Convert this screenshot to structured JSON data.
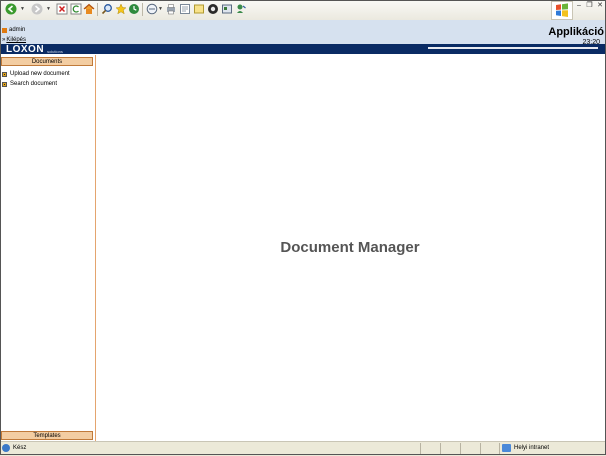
{
  "toolbar": {
    "buttons": [
      "back-icon",
      "forward-icon",
      "stop-icon",
      "refresh-icon",
      "home-icon",
      "search-icon",
      "favorites-icon",
      "history-icon",
      "mail-icon",
      "print-icon",
      "edit-icon",
      "messenger-icon",
      "media-icon",
      "discuss-icon",
      "research-icon"
    ]
  },
  "header": {
    "user": "admin",
    "logout": "Kilépés",
    "app_title": "Applikáció",
    "time": "23:20",
    "logo_text": "LOXON",
    "logo_sub": "solutions"
  },
  "sidebar": {
    "documents_title": "Documents",
    "items": [
      {
        "label": "Upload new document"
      },
      {
        "label": "Search document"
      }
    ],
    "templates_title": "Templates"
  },
  "main": {
    "title": "Document Manager"
  },
  "status": {
    "left": "Kész",
    "zone": "Helyi intranet"
  },
  "colors": {
    "header_bg": "#d6e1ef",
    "logo_strip": "#0a2b64",
    "panel_head": "#f3cda2",
    "accent_orange": "#e07a10"
  }
}
